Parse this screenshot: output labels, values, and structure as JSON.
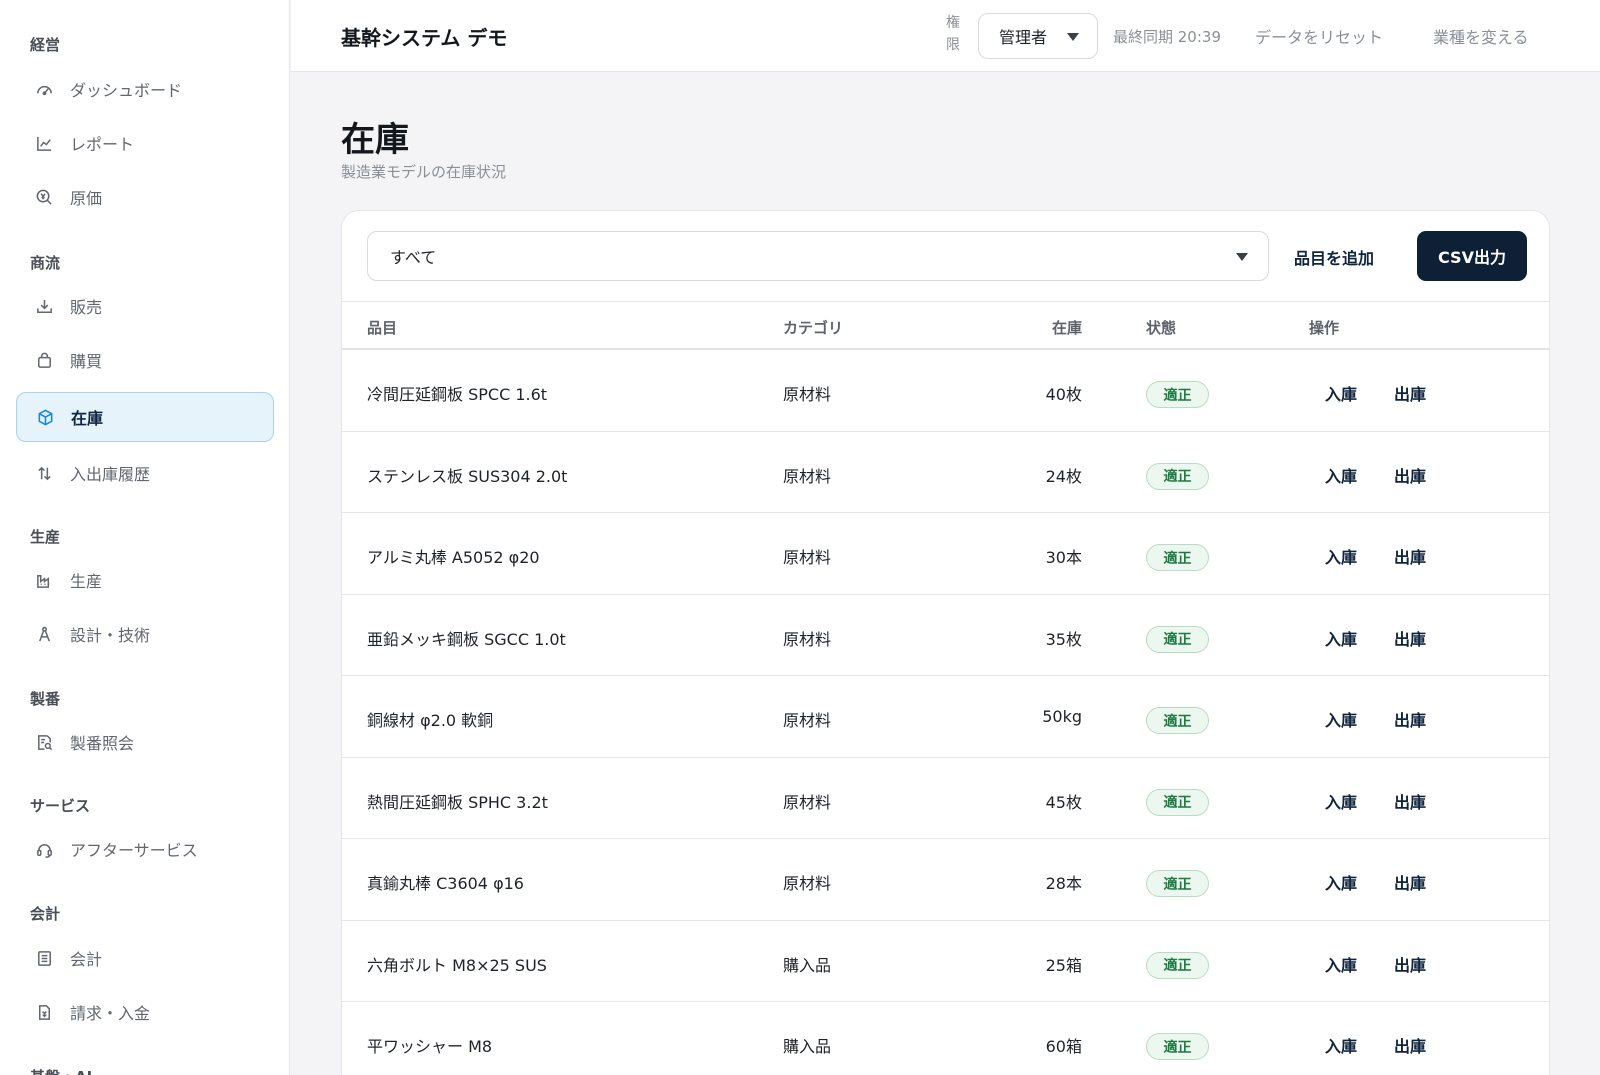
{
  "header": {
    "title": "基幹システム デモ",
    "role_label": "権限",
    "role_value": "管理者",
    "last_sync": "最終同期 20:39",
    "reset_label": "データをリセット",
    "industry_label": "業種を変える"
  },
  "sidebar": {
    "sections": [
      {
        "label": "経営",
        "items": [
          {
            "label": "ダッシュボード",
            "icon": "gauge-icon"
          },
          {
            "label": "レポート",
            "icon": "line-chart-icon"
          },
          {
            "label": "原価",
            "icon": "yen-search-icon"
          }
        ]
      },
      {
        "label": "商流",
        "items": [
          {
            "label": "販売",
            "icon": "download-tray-icon"
          },
          {
            "label": "購買",
            "icon": "shopping-bag-icon"
          },
          {
            "label": "在庫",
            "icon": "package-icon",
            "active": true
          },
          {
            "label": "入出庫履歴",
            "icon": "swap-vertical-icon"
          }
        ]
      },
      {
        "label": "生産",
        "items": [
          {
            "label": "生産",
            "icon": "factory-icon"
          },
          {
            "label": "設計・技術",
            "icon": "compass-icon"
          }
        ]
      },
      {
        "label": "製番",
        "items": [
          {
            "label": "製番照会",
            "icon": "document-search-icon"
          }
        ]
      },
      {
        "label": "サービス",
        "items": [
          {
            "label": "アフターサービス",
            "icon": "headset-icon"
          }
        ]
      },
      {
        "label": "会計",
        "items": [
          {
            "label": "会計",
            "icon": "ledger-icon"
          },
          {
            "label": "請求・入金",
            "icon": "invoice-icon"
          }
        ]
      },
      {
        "label": "基盤・AI",
        "items": []
      }
    ]
  },
  "main": {
    "title": "在庫",
    "subtitle": "製造業モデルの在庫状況",
    "filter_value": "すべて",
    "add_label": "品目を追加",
    "csv_label": "CSV出力",
    "columns": [
      "品目",
      "カテゴリ",
      "在庫",
      "状態",
      "操作"
    ],
    "action_in": "入庫",
    "action_out": "出庫",
    "status_color": "#1d7a43",
    "accent_color": "#0d2036",
    "rows": [
      {
        "item": "冷間圧延鋼板 SPCC 1.6t",
        "category": "原材料",
        "stock": "40枚",
        "status": "適正"
      },
      {
        "item": "ステンレス板 SUS304 2.0t",
        "category": "原材料",
        "stock": "24枚",
        "status": "適正"
      },
      {
        "item": "アルミ丸棒 A5052 φ20",
        "category": "原材料",
        "stock": "30本",
        "status": "適正"
      },
      {
        "item": "亜鉛メッキ鋼板 SGCC 1.0t",
        "category": "原材料",
        "stock": "35枚",
        "status": "適正"
      },
      {
        "item": "銅線材 φ2.0 軟銅",
        "category": "原材料",
        "stock": "50kg",
        "status": "適正"
      },
      {
        "item": "熱間圧延鋼板 SPHC 3.2t",
        "category": "原材料",
        "stock": "45枚",
        "status": "適正"
      },
      {
        "item": "真鍮丸棒 C3604 φ16",
        "category": "原材料",
        "stock": "28本",
        "status": "適正"
      },
      {
        "item": "六角ボルト M8×25 SUS",
        "category": "購入品",
        "stock": "25箱",
        "status": "適正"
      },
      {
        "item": "平ワッシャー M8",
        "category": "購入品",
        "stock": "60箱",
        "status": "適正"
      }
    ]
  }
}
